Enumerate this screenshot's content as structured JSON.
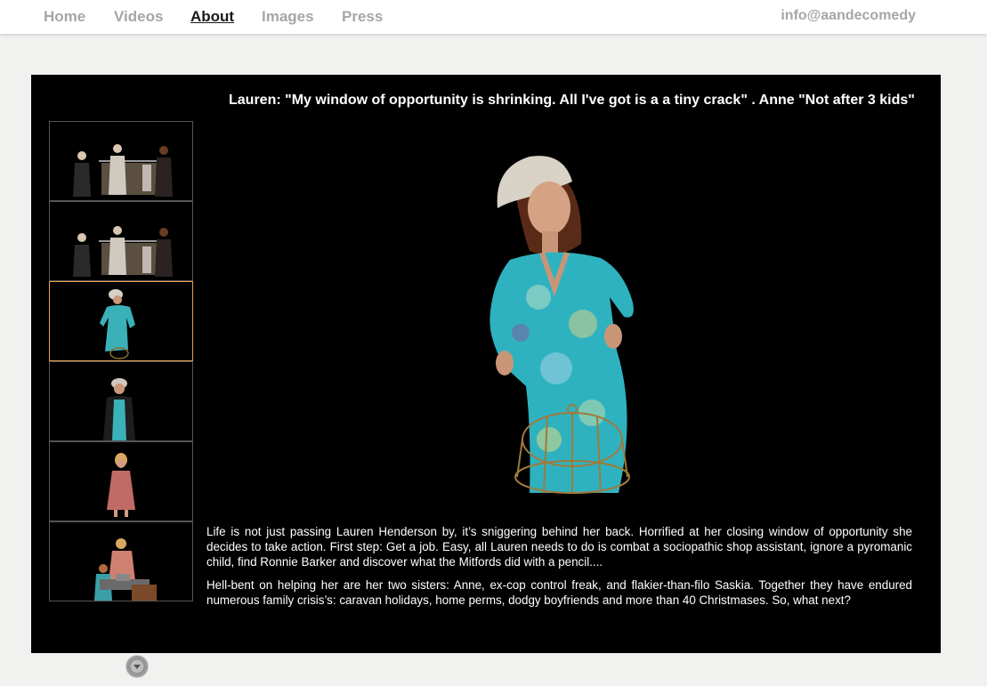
{
  "nav": {
    "items": [
      {
        "label": "Home",
        "active": false
      },
      {
        "label": "Videos",
        "active": false
      },
      {
        "label": "About",
        "active": true
      },
      {
        "label": "Images",
        "active": false
      },
      {
        "label": "Press",
        "active": false
      }
    ],
    "email": "info@aandecomedy"
  },
  "gallery": {
    "caption": "Lauren: \"My window of opportunity is shrinking. All I've got is a a tiny crack\" . Anne \"Not after 3 kids\"",
    "selected_index": 2,
    "thumbnails": [
      "three-sisters-rack",
      "three-sisters-rack",
      "lauren-blue-dress",
      "woman-beanie-jacket",
      "woman-pink-dress",
      "sisters-table-scene"
    ],
    "scroll_icon": "chevron-down-icon"
  },
  "description": {
    "paragraph1": "Life is not just passing Lauren Henderson by, it’s sniggering behind her back. Horrified at her closing window of opportunity she decides to take action. First step: Get a job. Easy, all Lauren needs to do is combat a sociopathic shop assistant, ignore a pyromanic child, find Ronnie Barker and discover what the Mitfords did with a pencil....",
    "paragraph2": "Hell-bent on helping her are her two sisters: Anne, ex-cop control freak, and flakier-than-filo Saskia. Together they have endured numerous family crisis’s: caravan holidays, home perms, dodgy boyfriends and more than 40 Christmases. So, what next?"
  },
  "colors": {
    "background": "#f1f1ef",
    "panel": "#000000",
    "nav_text": "#a6a6a6",
    "nav_active": "#1a1a1a",
    "selected_border": "#e8a050"
  }
}
